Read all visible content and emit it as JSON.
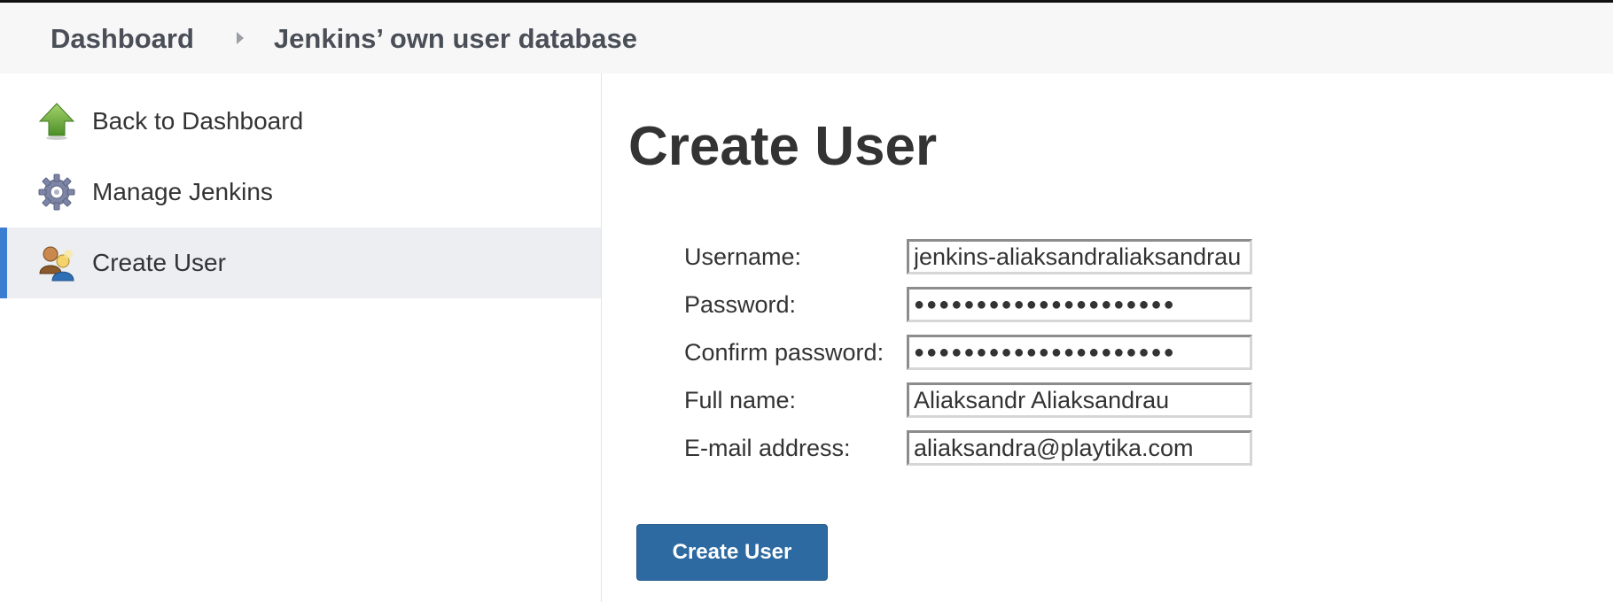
{
  "breadcrumb": {
    "items": [
      {
        "label": "Dashboard"
      },
      {
        "label": "Jenkins’ own user database"
      }
    ],
    "separator_icon": "chevron-right-icon"
  },
  "sidebar": {
    "items": [
      {
        "label": "Back to Dashboard",
        "icon": "up-arrow-icon",
        "active": false
      },
      {
        "label": "Manage Jenkins",
        "icon": "gear-icon",
        "active": false
      },
      {
        "label": "Create User",
        "icon": "users-icon",
        "active": true
      }
    ],
    "active_indicator_color": "#3d7dd1"
  },
  "main": {
    "title": "Create User",
    "form": {
      "username": {
        "label": "Username:",
        "value": "jenkins-aliaksandraliaksandrau"
      },
      "password": {
        "label": "Password:",
        "value": "●●●●●●●●●●●●●●●●●●●●●"
      },
      "confirm_password": {
        "label": "Confirm password:",
        "value": "●●●●●●●●●●●●●●●●●●●●●"
      },
      "full_name": {
        "label": "Full name:",
        "value": "Aliaksandr Aliaksandrau"
      },
      "email": {
        "label": "E-mail address:",
        "value": "aliaksandra@playtika.com"
      }
    },
    "submit_label": "Create User",
    "submit_color": "#2d6aa1"
  }
}
